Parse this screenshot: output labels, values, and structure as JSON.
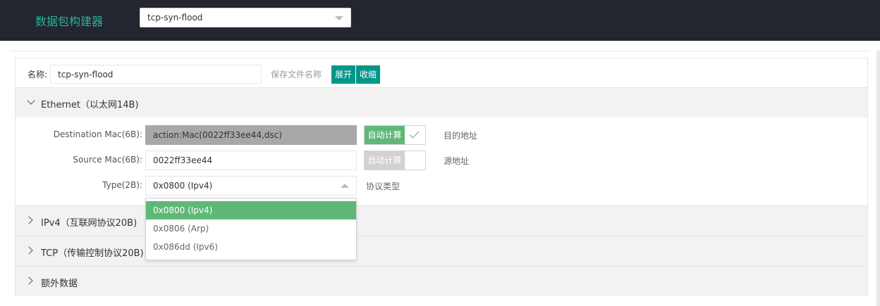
{
  "app": {
    "title": "数据包构建器",
    "template_select": {
      "value": "tcp-syn-flood"
    }
  },
  "name_row": {
    "label": "名称:",
    "value": "tcp-syn-flood",
    "hint": "保存文件名称",
    "expand_label": "展开",
    "collapse_label": "收缩"
  },
  "sections": {
    "ethernet": "Ethernet（以太网14B)",
    "ipv4": "IPv4（互联网协议20B)",
    "tcp": "TCP（传输控制协议20B)",
    "extra": "额外数据"
  },
  "ethernet": {
    "dest_mac": {
      "label": "Destination Mac(6B):",
      "value": "action:Mac(0022ff33ee44,dsc)",
      "auto_label": "自动计算",
      "auto_checked": true,
      "hint": "目的地址"
    },
    "src_mac": {
      "label": "Source Mac(6B):",
      "value": "0022ff33ee44",
      "auto_label": "自动计算",
      "auto_checked": false,
      "hint": "源地址"
    },
    "type": {
      "label": "Type(2B):",
      "value": "0x0800 (Ipv4)",
      "hint": "协议类型",
      "options": [
        "0x0800 (Ipv4)",
        "0x0806 (Arp)",
        "0x086dd (Ipv6)"
      ],
      "selected_index": 0
    }
  },
  "colors": {
    "topbar": "#23262e",
    "title_green": "#2bb19a",
    "button_teal": "#009688",
    "checked_green": "#5fb878"
  },
  "icons": {
    "select_caret": "caret-down-icon",
    "open_caret": "caret-up-icon",
    "section_open": "chevron-down-icon",
    "section_closed": "chevron-right-icon",
    "check": "check-icon"
  }
}
